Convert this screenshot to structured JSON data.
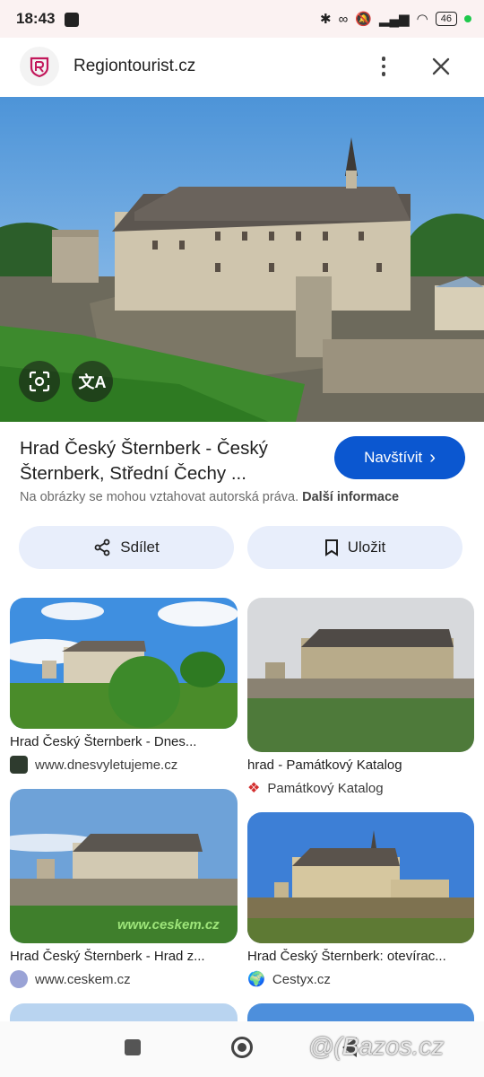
{
  "status": {
    "time": "18:43",
    "battery": "46"
  },
  "header": {
    "site": "Regiontourist.cz"
  },
  "result": {
    "title_line1": "Hrad Český Šternberk - Český",
    "title_line2": "Šternberk, Střední Čechy ...",
    "visit_label": "Navštívit",
    "copyright_text": "Na obrázky se mohou vztahovat autorská práva.",
    "more_info": "Další informace"
  },
  "actions": {
    "share": "Sdílet",
    "save": "Uložit"
  },
  "cards": [
    {
      "caption": "Hrad Český Šternberk - Dnes...",
      "source": "www.dnesvyletujeme.cz"
    },
    {
      "caption": "hrad - Památkový Katalog",
      "source": "Památkový Katalog"
    },
    {
      "caption": "Hrad Český Šternberk - Hrad z...",
      "source": "www.ceskem.cz",
      "overlay": "www.ceskem.cz"
    },
    {
      "caption": "Hrad Český Šternberk: otevírac...",
      "source": "Cestyx.cz"
    }
  ],
  "watermark": "@(Bazos.cz",
  "colors": {
    "accent": "#0b57d0",
    "pill_bg": "#e8eefb",
    "statusbar": "#fbf2f2"
  }
}
